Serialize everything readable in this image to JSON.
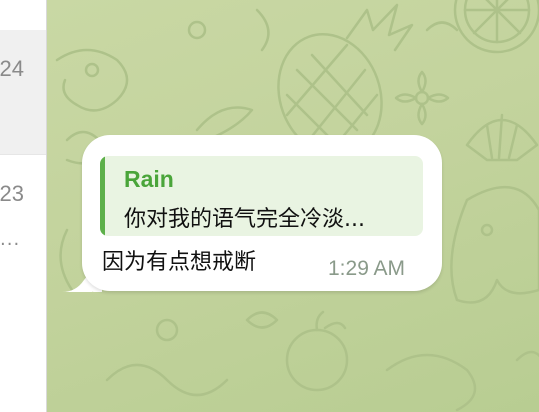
{
  "sidebar": {
    "items": [
      {
        "time": "24",
        "snippet": ""
      },
      {
        "time": "23",
        "snippet": "..."
      }
    ]
  },
  "message": {
    "reply": {
      "sender": "Rain",
      "text": "你对我的语气完全冷淡..."
    },
    "text": "因为有点想戒断",
    "time": "1:29 AM"
  },
  "colors": {
    "chat_background": "#c7d6a2",
    "bubble": "#ffffff",
    "reply_background": "#e9f4e2",
    "reply_accent": "#5db04a",
    "sender_name": "#4aa53a"
  }
}
